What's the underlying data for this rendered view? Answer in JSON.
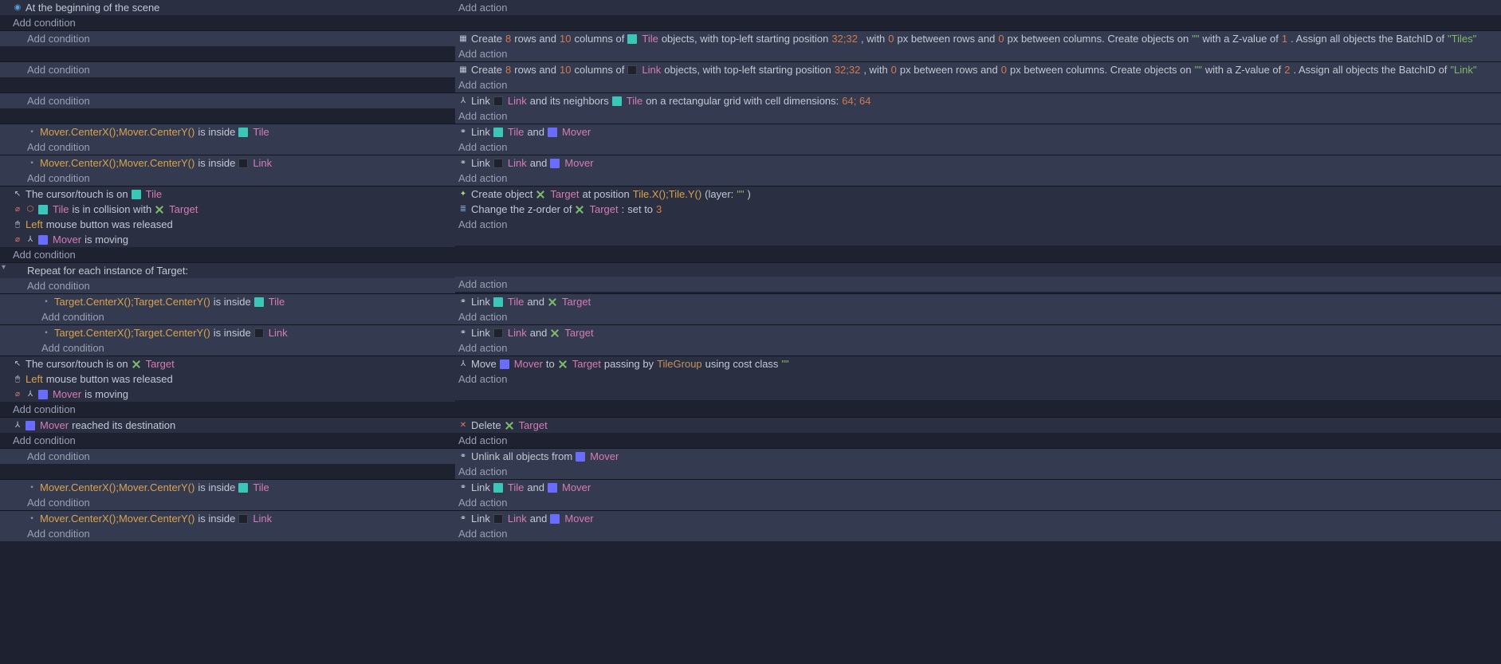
{
  "labels": {
    "add_condition": "Add condition",
    "add_action": "Add action"
  },
  "objects": {
    "tile": "Tile",
    "link": "Link",
    "mover": "Mover",
    "target": "Target",
    "tilegroup": "TileGroup"
  },
  "scene_begin": "At the beginning of the scene",
  "create_grid_a": {
    "pre": "Create ",
    "rows": "8",
    "mid1": " rows and ",
    "cols": "10",
    "mid2": " columns of ",
    "obj": "Tile",
    "post1": " objects, with top-left starting position ",
    "pos": "32;32",
    "post2": ", with ",
    "rowgap": "0",
    "post3": "px between rows and ",
    "colgap": "0",
    "post4": "px between columns. Create objects on ",
    "layer": "\"\"",
    "post5": " with a Z-value of ",
    "z": "1",
    "post6": ". Assign all objects the BatchID of ",
    "batch": "\"Tiles\""
  },
  "create_grid_b": {
    "pre": "Create ",
    "rows": "8",
    "mid1": " rows and ",
    "cols": "10",
    "mid2": " columns of ",
    "obj": "Link",
    "post1": " objects, with top-left starting position ",
    "pos": "32;32",
    "post2": ", with ",
    "rowgap": "0",
    "post3": "px between rows and ",
    "colgap": "0",
    "post4": "px between columns. Create objects on ",
    "layer": "\"\"",
    "post5": " with a Z-value of ",
    "z": "2",
    "post6": ". Assign all objects the BatchID of ",
    "batch": "\"Link\""
  },
  "link_neighbors": {
    "pre": "Link ",
    "a": "Link",
    "mid": " and its neighbors ",
    "b": "Tile",
    "post": " on a rectangular grid with cell dimensions: ",
    "dims": "64; 64"
  },
  "mover_inside_tile": {
    "expr": "Mover.CenterX();Mover.CenterY()",
    "mid": " is inside ",
    "obj": "Tile"
  },
  "mover_inside_link": {
    "expr": "Mover.CenterX();Mover.CenterY()",
    "mid": " is inside ",
    "obj": "Link"
  },
  "link_tile_mover": {
    "pre": "Link ",
    "a": "Tile",
    "mid": " and ",
    "b": "Mover"
  },
  "link_link_mover": {
    "pre": "Link ",
    "a": "Link",
    "mid": " and ",
    "b": "Mover"
  },
  "cursor_on_tile": {
    "pre": "The cursor/touch is on ",
    "obj": "Tile"
  },
  "tile_collide_target": {
    "a": "Tile",
    "mid": " is in collision with ",
    "b": "Target"
  },
  "left_released": {
    "key": "Left",
    "post": " mouse button was released"
  },
  "mover_moving": {
    "obj": "Mover",
    "post": " is moving"
  },
  "create_target": {
    "pre": "Create object ",
    "obj": "Target",
    "mid": " at position ",
    "expr": "Tile.X();Tile.Y()",
    "post": " (layer: ",
    "layer": "\"\"",
    "end": ")"
  },
  "zorder_target": {
    "pre": "Change the z-order of ",
    "obj": "Target",
    "mid": ": ",
    "op": "set to ",
    "val": "3"
  },
  "repeat_target": "Repeat for each instance of Target:",
  "target_inside_tile": {
    "expr": "Target.CenterX();Target.CenterY()",
    "mid": " is inside ",
    "obj": "Tile"
  },
  "target_inside_link": {
    "expr": "Target.CenterX();Target.CenterY()",
    "mid": " is inside ",
    "obj": "Link"
  },
  "link_tile_target": {
    "pre": "Link ",
    "a": "Tile",
    "mid": " and ",
    "b": "Target"
  },
  "link_link_target": {
    "pre": "Link ",
    "a": "Link",
    "mid": " and ",
    "b": "Target"
  },
  "cursor_on_target": {
    "pre": "The cursor/touch is on ",
    "obj": "Target"
  },
  "move_mover": {
    "pre": "Move ",
    "a": "Mover",
    "mid1": " to ",
    "b": "Target",
    "mid2": " passing by ",
    "c": "TileGroup",
    "post": " using cost class ",
    "cls": "\"\""
  },
  "mover_reached": {
    "obj": "Mover",
    "post": " reached its destination"
  },
  "delete_target": {
    "pre": "Delete ",
    "obj": "Target"
  },
  "unlink_mover": {
    "pre": "Unlink all objects from ",
    "obj": "Mover"
  }
}
